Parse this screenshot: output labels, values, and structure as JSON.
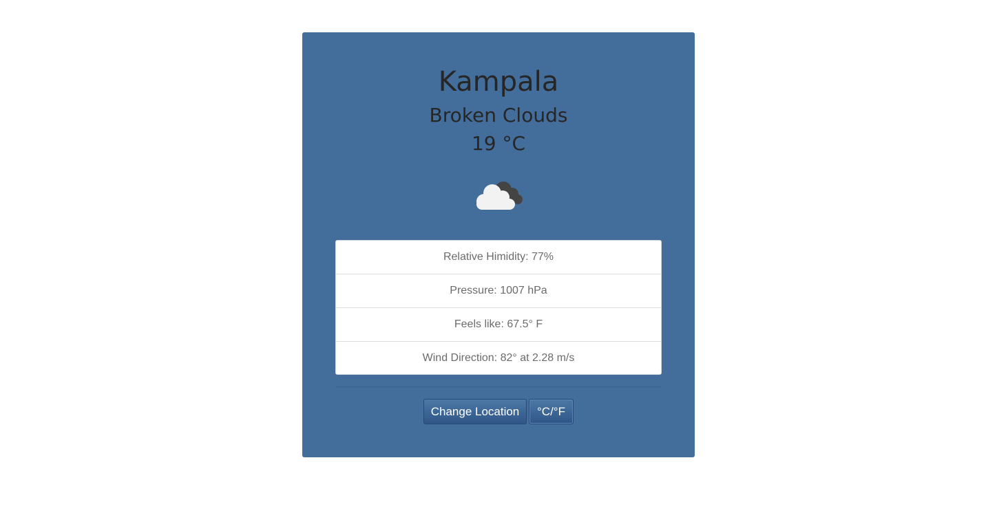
{
  "weather": {
    "city": "Kampala",
    "condition": "Broken Clouds",
    "temperature": "19 °C",
    "icon": "broken-clouds-icon"
  },
  "details": [
    {
      "label": "Relative Himidity: 77%"
    },
    {
      "label": "Pressure: 1007 hPa"
    },
    {
      "label": "Feels like: 67.5° F"
    },
    {
      "label": "Wind Direction: 82° at 2.28 m/s"
    }
  ],
  "actions": {
    "change_location_label": "Change Location",
    "toggle_units_label": "°C/°F"
  },
  "colors": {
    "page_background": "#ffffff",
    "card_background": "#436d9b",
    "button_background": "#3d6797",
    "text_dark": "#262626",
    "detail_text": "#6b6b6b"
  }
}
